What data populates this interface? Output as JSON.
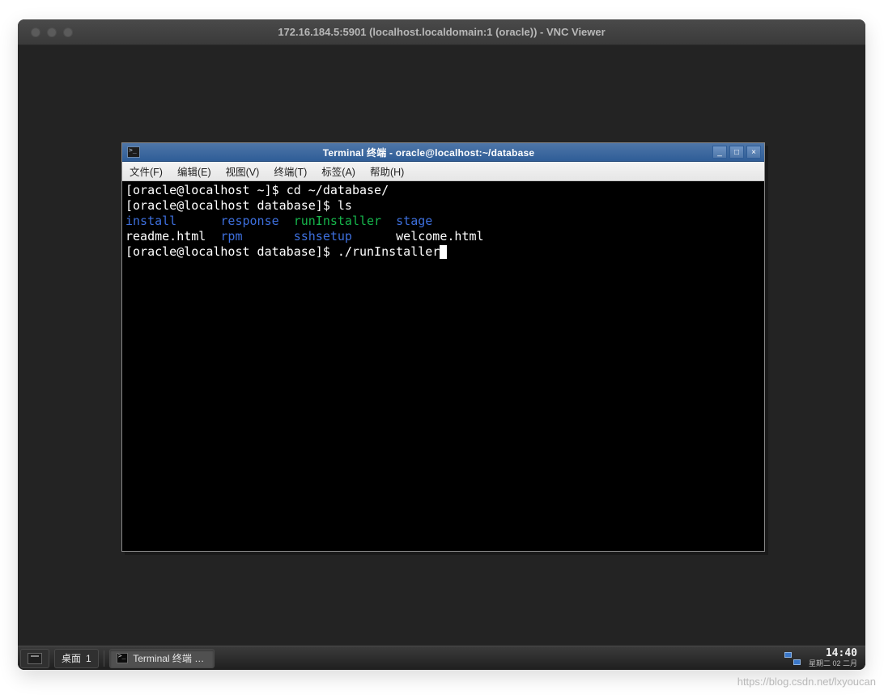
{
  "mac": {
    "title": "172.16.184.5:5901 (localhost.localdomain:1 (oracle)) - VNC Viewer"
  },
  "terminal_window": {
    "title": "Terminal 终端 - oracle@localhost:~/database",
    "menu": {
      "file": "文件(F)",
      "edit": "编辑(E)",
      "view": "视图(V)",
      "term": "终端(T)",
      "tabs": "标签(A)",
      "help": "帮助(H)"
    },
    "win_controls": {
      "min": "_",
      "max": "□",
      "close": "×"
    }
  },
  "term": {
    "line1_prompt": "[oracle@localhost ~]$ ",
    "line1_cmd": "cd ~/database/",
    "line2_prompt": "[oracle@localhost database]$ ",
    "line2_cmd": "ls",
    "ls_row1": {
      "install": "install",
      "response": "response",
      "runInstaller": "runInstaller",
      "stage": "stage"
    },
    "ls_row2": {
      "readme": "readme.html",
      "rpm": "rpm",
      "sshsetup": "sshsetup",
      "welcome": "welcome.html"
    },
    "line5_prompt": "[oracle@localhost database]$ ",
    "line5_cmd": "./runInstaller"
  },
  "taskbar": {
    "desktop_label": "桌面",
    "desktop_num": "1",
    "task_label": "Terminal 终端 - o…",
    "time": "14:40",
    "date": "星期二 02 二月"
  },
  "watermark": "https://blog.csdn.net/lxyoucan"
}
